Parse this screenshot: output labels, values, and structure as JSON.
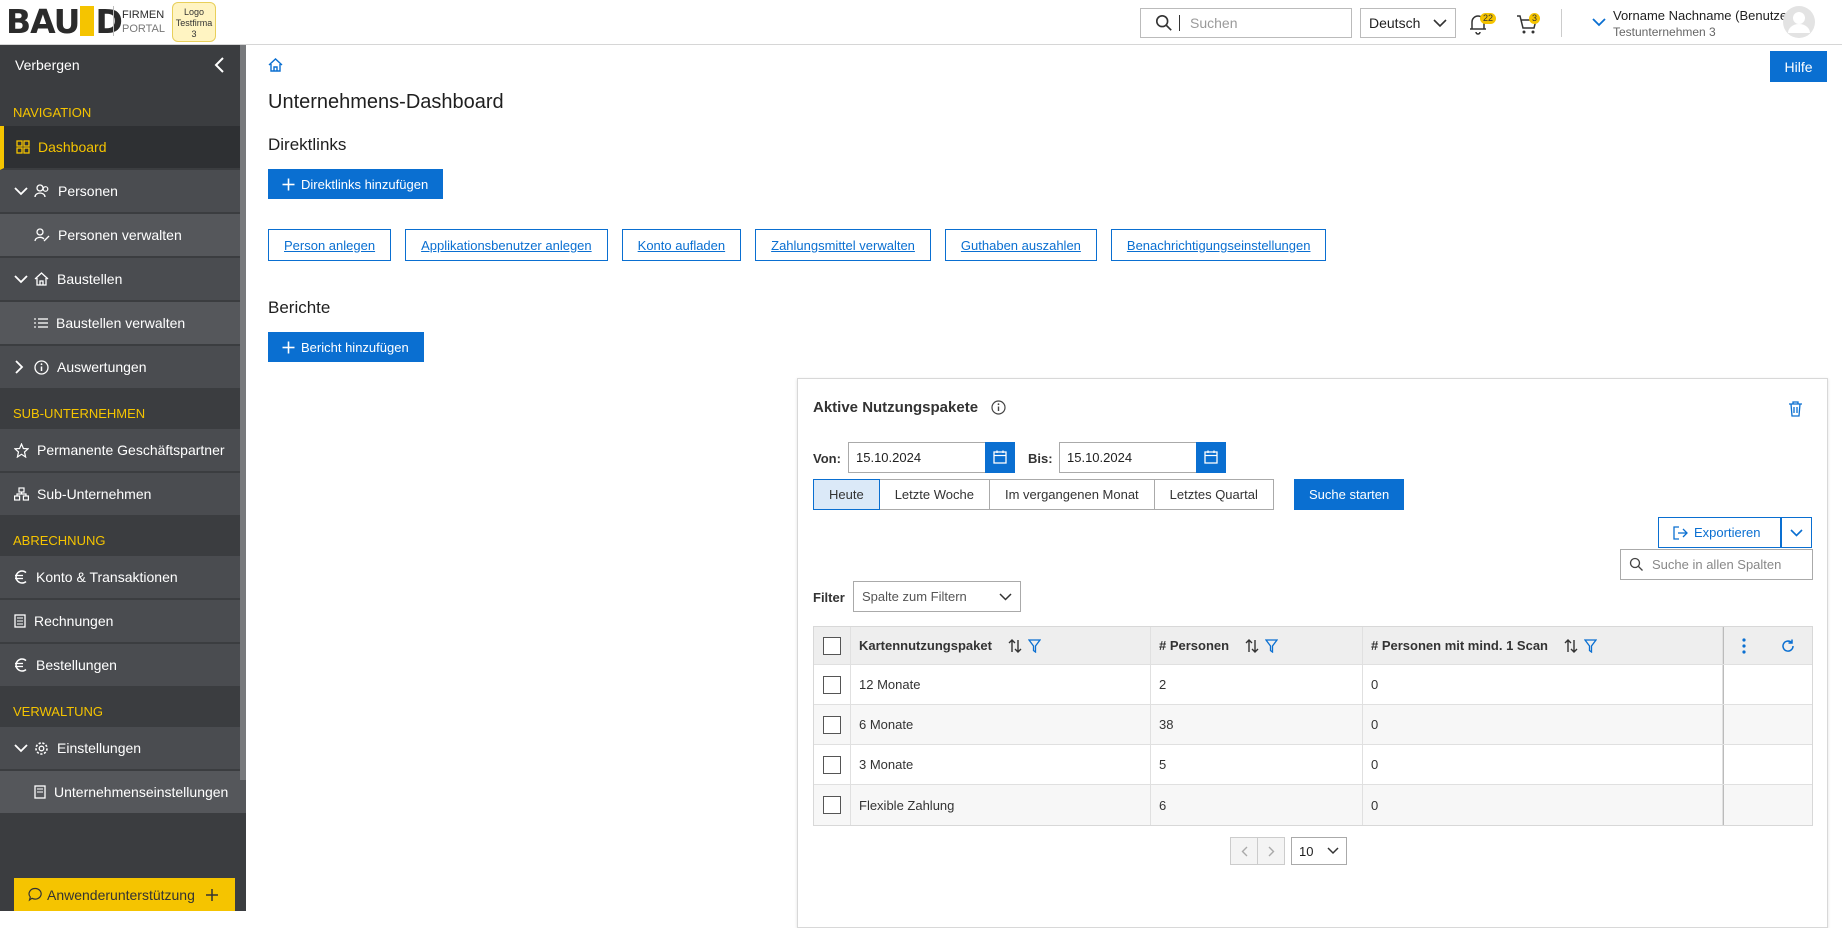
{
  "header": {
    "logo_text": "BAU ID",
    "portal_line1": "FIRMEN",
    "portal_line2": "PORTAL",
    "testfirma_logo": "Logo Testfirma 3",
    "search_placeholder": "Suchen",
    "language": "Deutsch",
    "notifications_count": "22",
    "cart_count": "3",
    "user_name": "Vorname Nachname (Benutzer)",
    "company": "Testunternehmen 3"
  },
  "sidebar": {
    "hide_label": "Verbergen",
    "sections": {
      "navigation": "NAVIGATION",
      "sub": "SUB-UNTERNEHMEN",
      "billing": "ABRECHNUNG",
      "admin": "VERWALTUNG"
    },
    "items": {
      "dashboard": "Dashboard",
      "persons": "Personen",
      "persons_manage": "Personen verwalten",
      "sites": "Baustellen",
      "sites_manage": "Baustellen verwalten",
      "reports": "Auswertungen",
      "partners": "Permanente Geschäftspartner",
      "subcompanies": "Sub-Unternehmen",
      "account": "Konto & Transaktionen",
      "invoices": "Rechnungen",
      "orders": "Bestellungen",
      "settings": "Einstellungen",
      "company_settings": "Unternehmenseinstellungen"
    },
    "support_label": "Anwenderunterstützung"
  },
  "main": {
    "help_label": "Hilfe",
    "title": "Unternehmens-Dashboard",
    "direct_links_title": "Direktlinks",
    "add_direct_links": "Direktlinks hinzufügen",
    "quick_links": [
      "Person anlegen",
      "Applikationsbenutzer anlegen",
      "Konto aufladen",
      "Zahlungsmittel verwalten",
      "Guthaben auszahlen",
      "Benachrichtigungseinstellungen"
    ],
    "reports_title": "Berichte",
    "add_report": "Bericht hinzufügen"
  },
  "widget": {
    "title": "Aktive Nutzungspakete",
    "from_label": "Von:",
    "from_date": "15.10.2024",
    "to_label": "Bis:",
    "to_date": "15.10.2024",
    "periods": [
      "Heute",
      "Letzte Woche",
      "Im vergangenen Monat",
      "Letztes Quartal"
    ],
    "start_search": "Suche starten",
    "export_label": "Exportieren",
    "column_search_placeholder": "Suche in allen Spalten",
    "filter_label": "Filter",
    "filter_placeholder": "Spalte zum Filtern",
    "columns": [
      "Kartennutzungspaket",
      "# Personen",
      "# Personen mit mind. 1 Scan"
    ],
    "rows": [
      {
        "package": "12 Monate",
        "persons": "2",
        "scanned": "0"
      },
      {
        "package": "6 Monate",
        "persons": "38",
        "scanned": "0"
      },
      {
        "package": "3 Monate",
        "persons": "5",
        "scanned": "0"
      },
      {
        "package": "Flexible Zahlung",
        "persons": "6",
        "scanned": "0"
      }
    ],
    "page_size": "10"
  },
  "colors": {
    "accent": "#f5c400",
    "primary": "#0a6fd1",
    "sidebar": "#3b3d40"
  }
}
